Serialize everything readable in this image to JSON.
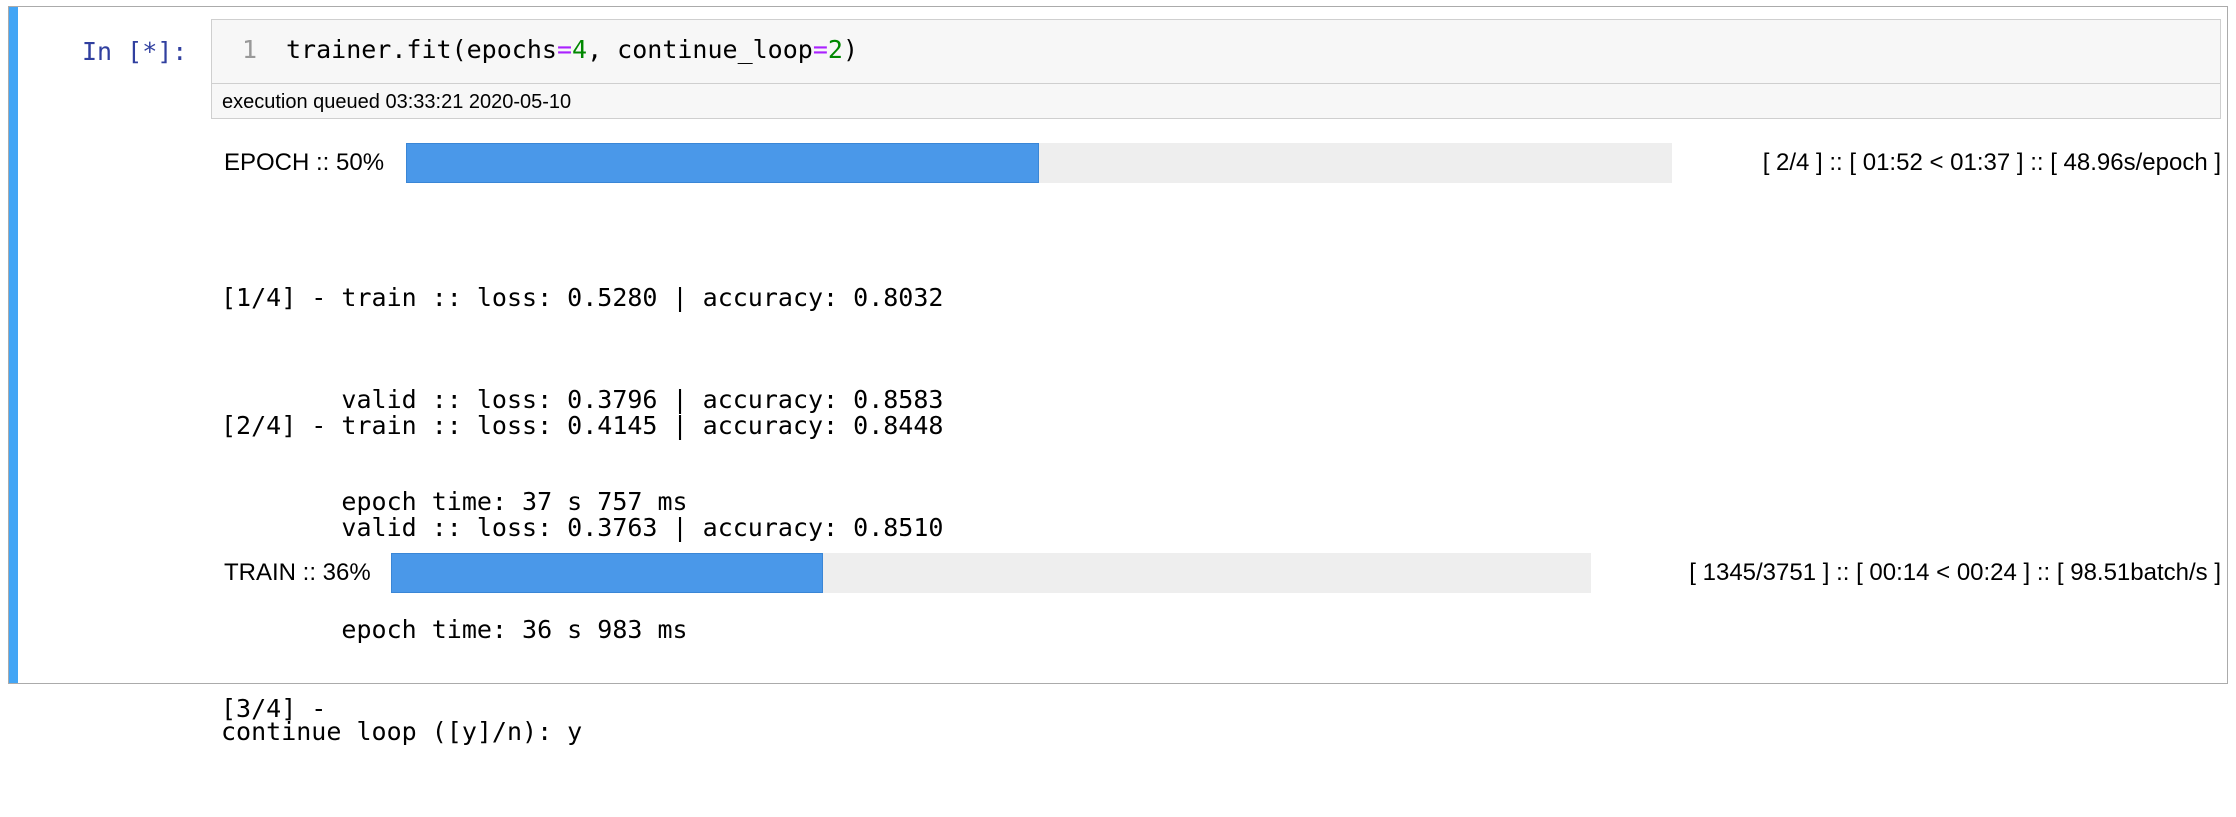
{
  "cell": {
    "prompt": "In [*]:",
    "line_number": "1",
    "code": {
      "t1": "trainer.fit(epochs",
      "t2": "=",
      "t3": "4",
      "t4": ", continue_loop",
      "t5": "=",
      "t6": "2",
      "t7": ")"
    },
    "execution_status": "execution queued 03:33:21 2020-05-10"
  },
  "output": {
    "epoch_progress": {
      "label": "EPOCH :: 50%",
      "percent": 50,
      "info": "[ 2/4 ] :: [ 01:52 < 01:37 ] :: [ 48.96s/epoch ]"
    },
    "log_block_1": [
      "[1/4] - train :: loss: 0.5280 | accuracy: 0.8032",
      "        valid :: loss: 0.3796 | accuracy: 0.8583",
      "        epoch time: 37 s 757 ms"
    ],
    "log_block_2": [
      "[2/4] - train :: loss: 0.4145 | accuracy: 0.8448",
      "        valid :: loss: 0.3763 | accuracy: 0.8510",
      "        epoch time: 36 s 983 ms",
      "continue loop ([y]/n): y"
    ],
    "train_progress": {
      "label": "TRAIN :: 36%",
      "percent": 36,
      "info": "[ 1345/3751 ] :: [ 00:14 < 00:24 ] :: [ 98.51batch/s ]"
    },
    "log_block_3": [
      "[3/4] -"
    ]
  },
  "colors": {
    "accent": "#42a5f5",
    "progress_fill": "#4a98e9",
    "progress_track": "#eeeeee",
    "prompt": "#303f9f"
  }
}
